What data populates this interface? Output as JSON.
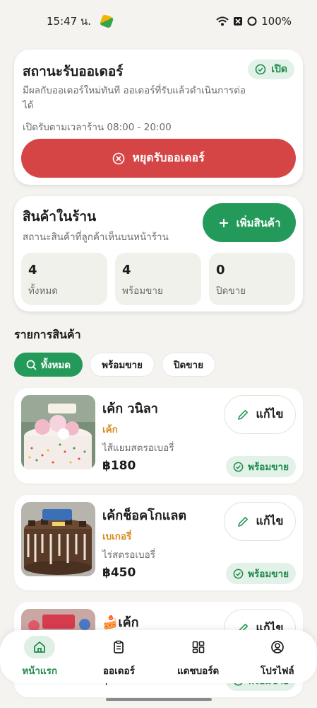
{
  "status_bar": {
    "time": "15:47 น.",
    "battery": "100%"
  },
  "order_status": {
    "title": "สถานะรับออเดอร์",
    "badge": "เปิด",
    "description": "มีผลกับออเดอร์ใหม่ทันที ออเดอร์ที่รับแล้วดำเนินการต่อได้",
    "hours": "เปิดรับตามเวลาร้าน 08:00 - 20:00",
    "stop_button": "หยุดรับออเดอร์"
  },
  "products_card": {
    "title": "สินค้าในร้าน",
    "subtitle": "สถานะสินค้าที่ลูกค้าเห็นบนหน้าร้าน",
    "add_button": "เพิ่มสินค้า",
    "stats": [
      {
        "value": "4",
        "label": "ทั้งหมด"
      },
      {
        "value": "4",
        "label": "พร้อมขาย"
      },
      {
        "value": "0",
        "label": "ปิดขาย"
      }
    ]
  },
  "list": {
    "title": "รายการสินค้า",
    "filters": [
      "ทั้งหมด",
      "พร้อมขาย",
      "ปิดขาย"
    ],
    "items": [
      {
        "name": "เค้ก วนิลา",
        "category": "เค้ก",
        "description": "ไส้แยมสตรอเบอรี่",
        "price": "฿180",
        "edit": "แก้ไข",
        "status": "พร้อมขาย"
      },
      {
        "name": "เค้กช็อคโกแลต",
        "category": "เบเกอรี่",
        "description": "ไร่สตรอเบอรี่",
        "price": "฿450",
        "edit": "แก้ไข",
        "status": "พร้อมขาย"
      },
      {
        "name": "🍰เค้ก",
        "category": "",
        "description": "",
        "price": "฿120",
        "edit": "แก้ไข",
        "status": "พร้อมขาย"
      }
    ]
  },
  "nav": {
    "items": [
      {
        "label": "หน้าแรก",
        "icon": "home-icon"
      },
      {
        "label": "ออเดอร์",
        "icon": "clipboard-icon"
      },
      {
        "label": "แดชบอร์ด",
        "icon": "dashboard-icon"
      },
      {
        "label": "โปรไฟล์",
        "icon": "profile-icon"
      }
    ]
  },
  "colors": {
    "accent": "#249a5a",
    "danger": "#d64545",
    "category": "#d98a1f",
    "background": "#f4f3ef"
  }
}
